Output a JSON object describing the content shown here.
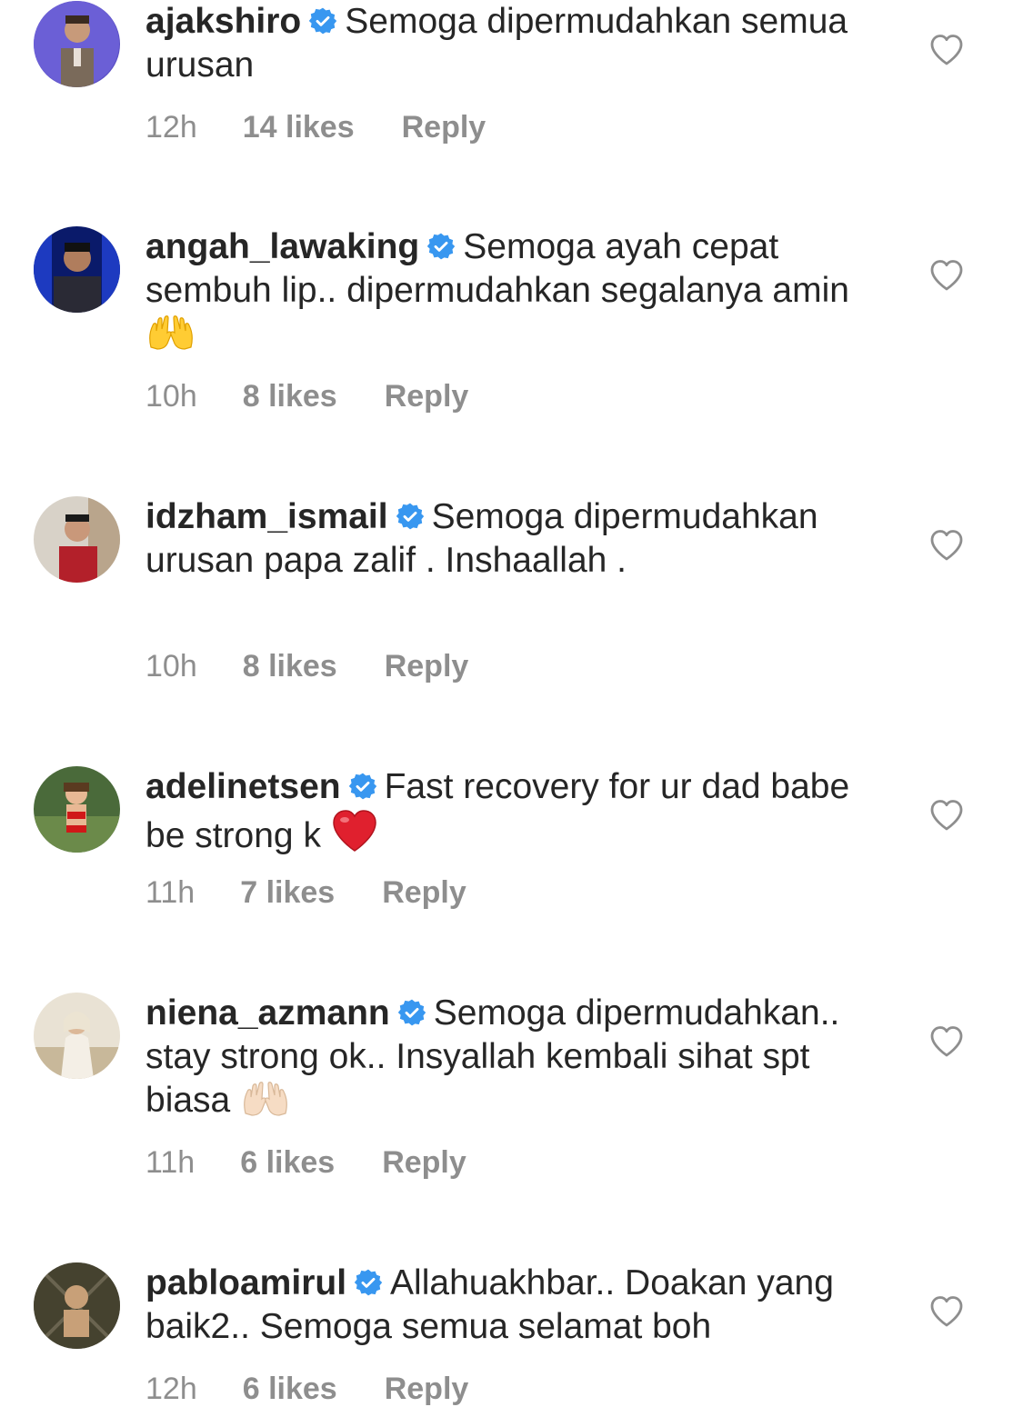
{
  "comments": [
    {
      "username": "ajakshiro",
      "text": "Semoga dipermudahkan semua urusan",
      "time": "12h",
      "likes": "14 likes",
      "reply_label": "Reply"
    },
    {
      "username": "angah_lawaking",
      "text": "Semoga ayah cepat sembuh lip.. dipermudahkan segalanya amin",
      "emoji": "raising-hands-yellow",
      "time": "10h",
      "likes": "8 likes",
      "reply_label": "Reply"
    },
    {
      "username": "idzham_ismail",
      "text": "Semoga dipermudahkan urusan papa zalif . Inshaallah .",
      "time": "10h",
      "likes": "8 likes",
      "reply_label": "Reply"
    },
    {
      "username": "adelinetsen",
      "text": "Fast recovery for ur dad babe be strong k",
      "emoji": "red-heart",
      "time": "11h",
      "likes": "7 likes",
      "reply_label": "Reply"
    },
    {
      "username": "niena_azmann",
      "text": "Semoga dipermudahkan.. stay strong ok.. Insyallah kembali sihat spt biasa",
      "emoji": "raising-hands-light",
      "time": "11h",
      "likes": "6 likes",
      "reply_label": "Reply"
    },
    {
      "username": "pabloamirul",
      "text": "Allahuakhbar.. Doakan yang baik2.. Semoga semua selamat boh",
      "time": "12h",
      "likes": "6 likes",
      "reply_label": "Reply"
    }
  ],
  "colors": {
    "text": "#262626",
    "meta": "#8e8e8e",
    "verified_badge": "#3897f0",
    "heart_outline": "#8e8e8e"
  },
  "icons": {
    "verified": "verified-badge-icon",
    "like": "heart-outline-icon"
  }
}
